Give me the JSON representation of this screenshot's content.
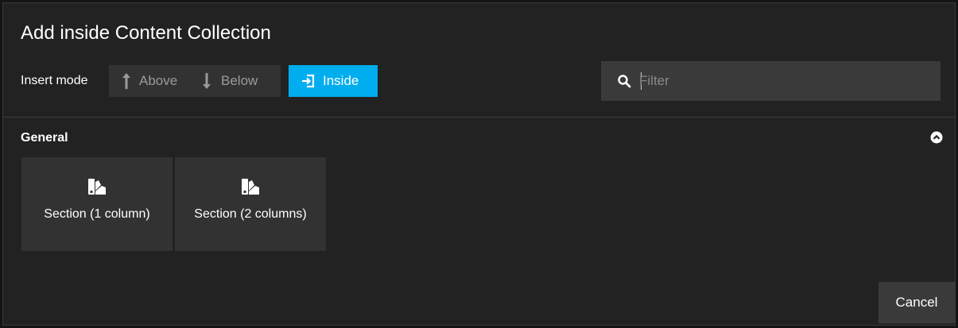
{
  "dialog": {
    "title": "Add inside Content Collection",
    "insert_mode_label": "Insert mode",
    "modes": [
      {
        "label": "Above",
        "icon": "long-arrow-up-icon",
        "selected": false
      },
      {
        "label": "Below",
        "icon": "long-arrow-down-icon",
        "selected": false
      },
      {
        "label": "Inside",
        "icon": "sign-in-icon",
        "selected": true
      }
    ],
    "filter": {
      "placeholder": "Filter",
      "value": ""
    },
    "group": {
      "title": "General",
      "collapse_icon": "chevron-circle-up-icon",
      "items": [
        {
          "label": "Section (1 column)",
          "icon": "swatchbook-icon"
        },
        {
          "label": "Section (2 columns)",
          "icon": "swatchbook-icon"
        }
      ]
    },
    "cancel_label": "Cancel"
  },
  "colors": {
    "dialog_bg": "#222222",
    "button_bg": "#323232",
    "accent": "#00adee",
    "input_bg": "#3a3a3a"
  }
}
